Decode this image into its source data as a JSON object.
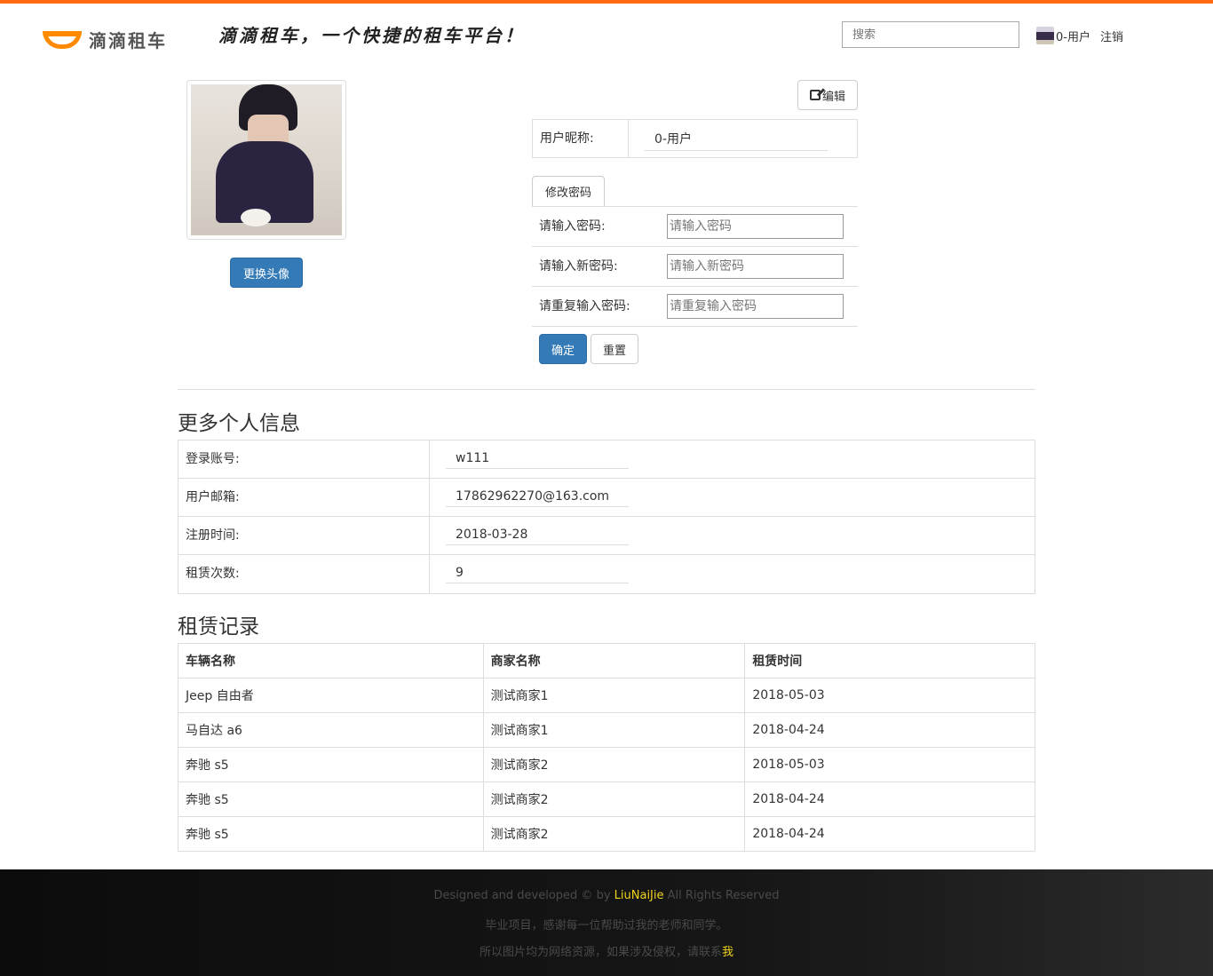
{
  "header": {
    "logo_text": "滴滴租车",
    "slogan": "滴滴租车，一个快捷的租车平台！",
    "search_placeholder": "搜索",
    "username": "0-用户",
    "logout": "注销"
  },
  "colors": {
    "accent": "#ff6a13",
    "primary": "#337ab7",
    "link_highlight": "#f0d31c"
  },
  "profile": {
    "change_avatar": "更换头像",
    "edit_label": "编辑",
    "nickname_label": "用户昵称:",
    "nickname_value": "0-用户"
  },
  "password": {
    "tab_label": "修改密码",
    "rows": [
      {
        "label": "请输入密码:",
        "placeholder": "请输入密码"
      },
      {
        "label": "请输入新密码:",
        "placeholder": "请输入新密码"
      },
      {
        "label": "请重复输入密码:",
        "placeholder": "请重复输入密码"
      }
    ],
    "confirm": "确定",
    "reset": "重置"
  },
  "more_info": {
    "title": "更多个人信息",
    "rows": [
      {
        "label": "登录账号:",
        "value": "w111"
      },
      {
        "label": "用户邮箱:",
        "value": "17862962270@163.com"
      },
      {
        "label": "注册时间:",
        "value": "2018-03-28"
      },
      {
        "label": "租赁次数:",
        "value": "9"
      }
    ]
  },
  "rentals": {
    "title": "租赁记录",
    "columns": [
      "车辆名称",
      "商家名称",
      "租赁时间"
    ],
    "rows": [
      [
        "Jeep 自由者",
        "测试商家1",
        "2018-05-03"
      ],
      [
        "马自达 a6",
        "测试商家1",
        "2018-04-24"
      ],
      [
        "奔驰 s5",
        "测试商家2",
        "2018-05-03"
      ],
      [
        "奔驰 s5",
        "测试商家2",
        "2018-04-24"
      ],
      [
        "奔驰 s5",
        "测试商家2",
        "2018-04-24"
      ]
    ]
  },
  "footer": {
    "line1_prefix": "Designed and developed © by",
    "line1_author": "LiuNaiJie",
    "line1_suffix": "All Rights Reserved",
    "line2": "毕业项目，感谢每一位帮助过我的老师和同学。",
    "line3_prefix": "所以图片均为网络资源，如果涉及侵权，请联系",
    "line3_link": "我"
  }
}
